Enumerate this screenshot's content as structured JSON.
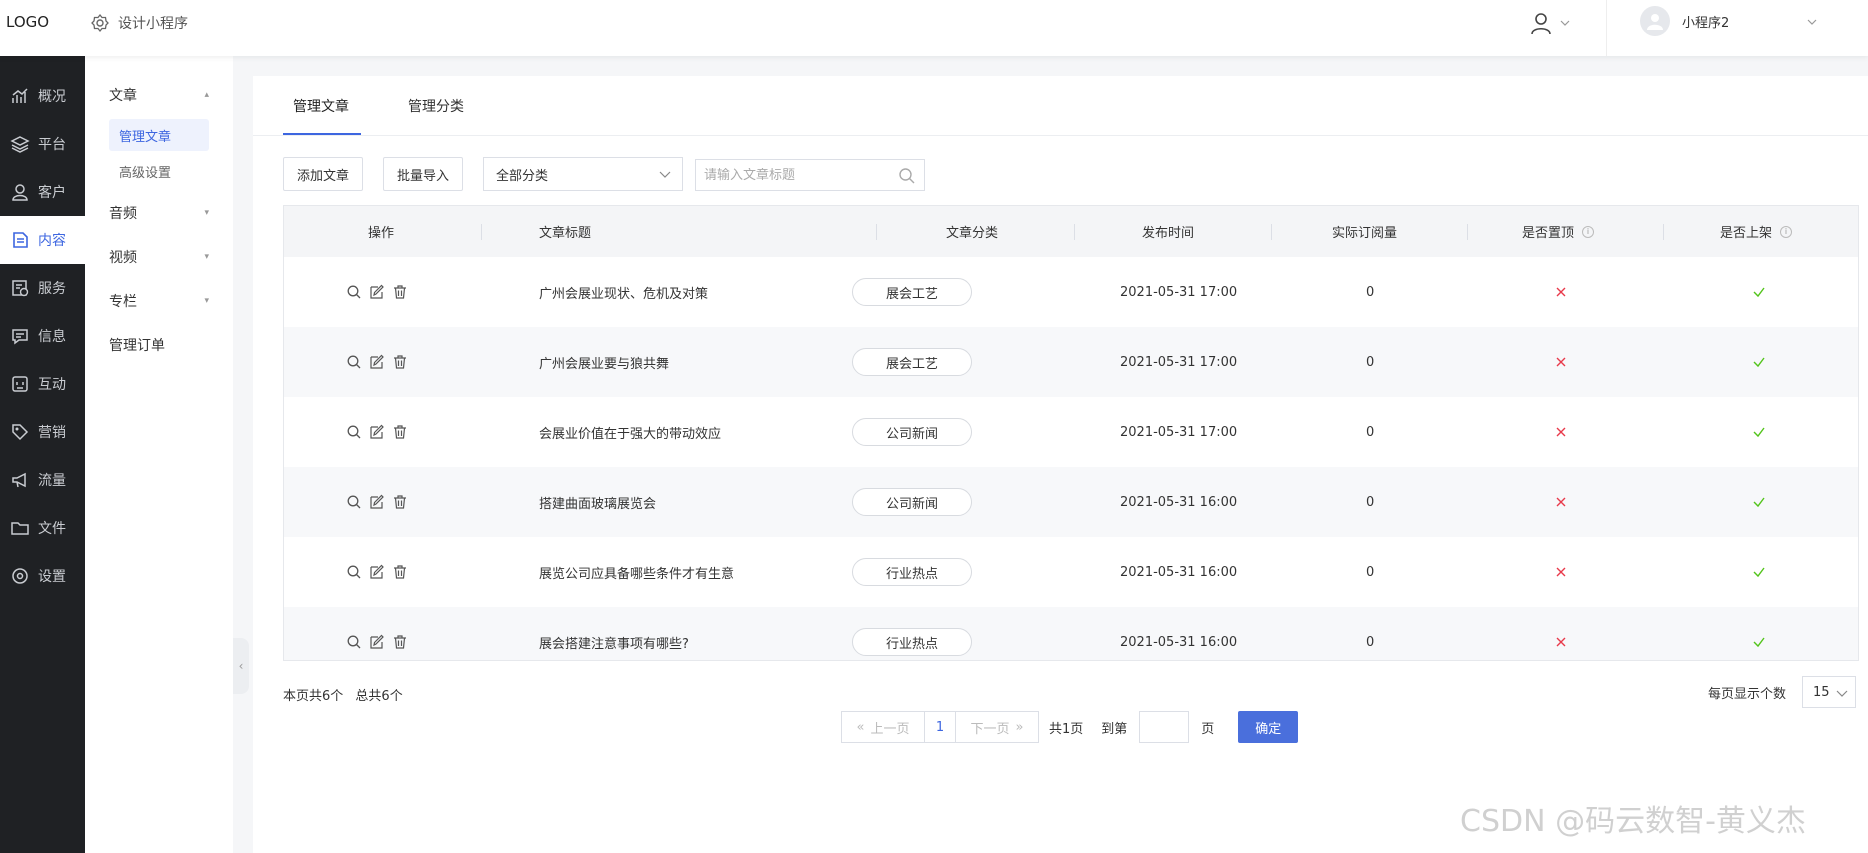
{
  "header": {
    "logo": "LOGO",
    "design_label": "设计小程序",
    "account_name": "小程序2",
    "icons": [
      "user-icon",
      "chevron-down-icon",
      "settings-icon"
    ]
  },
  "leftnav": {
    "items": [
      {
        "label": "概况",
        "icon": "chart-icon"
      },
      {
        "label": "平台",
        "icon": "layers-icon"
      },
      {
        "label": "客户",
        "icon": "user-icon"
      },
      {
        "label": "内容",
        "icon": "document-icon",
        "active": true
      },
      {
        "label": "服务",
        "icon": "service-icon"
      },
      {
        "label": "信息",
        "icon": "message-icon"
      },
      {
        "label": "互动",
        "icon": "interact-icon"
      },
      {
        "label": "营销",
        "icon": "tag-icon"
      },
      {
        "label": "流量",
        "icon": "megaphone-icon"
      },
      {
        "label": "文件",
        "icon": "folder-icon"
      },
      {
        "label": "设置",
        "icon": "gear-icon"
      }
    ]
  },
  "subnav": {
    "group_article": "文章",
    "item_manage_article": "管理文章",
    "item_advanced": "高级设置",
    "group_audio": "音频",
    "group_video": "视频",
    "group_column": "专栏",
    "item_orders": "管理订单"
  },
  "tabs": [
    "管理文章",
    "管理分类"
  ],
  "toolbar": {
    "add_label": "添加文章",
    "import_label": "批量导入",
    "category_selected": "全部分类",
    "search_placeholder": "请输入文章标题"
  },
  "table": {
    "columns": [
      "操作",
      "文章标题",
      "文章分类",
      "发布时间",
      "实际订阅量",
      "是否置顶",
      "是否上架"
    ],
    "rows": [
      {
        "title": "广州会展业现状、危机及对策",
        "category": "展会工艺",
        "time": "2021-05-31 17:00",
        "subs": "0",
        "top": false,
        "listed": true
      },
      {
        "title": "广州会展业要与狼共舞",
        "category": "展会工艺",
        "time": "2021-05-31 17:00",
        "subs": "0",
        "top": false,
        "listed": true
      },
      {
        "title": "会展业价值在于强大的带动效应",
        "category": "公司新闻",
        "time": "2021-05-31 17:00",
        "subs": "0",
        "top": false,
        "listed": true
      },
      {
        "title": "搭建曲面玻璃展览会",
        "category": "公司新闻",
        "time": "2021-05-31 16:00",
        "subs": "0",
        "top": false,
        "listed": true
      },
      {
        "title": "展览公司应具备哪些条件才有生意",
        "category": "行业热点",
        "time": "2021-05-31 16:00",
        "subs": "0",
        "top": false,
        "listed": true
      },
      {
        "title": "展会搭建注意事项有哪些?",
        "category": "行业热点",
        "time": "2021-05-31 16:00",
        "subs": "0",
        "top": false,
        "listed": true
      }
    ]
  },
  "footer": {
    "page_count": "本页共6个",
    "total_count": "总共6个",
    "per_page_label": "每页显示个数",
    "per_page_value": "15",
    "prev": "上一页",
    "current_page": "1",
    "next": "下一页",
    "total_pages": "共1页",
    "goto_label": "到第",
    "page_suffix": "页",
    "confirm": "确定"
  },
  "watermark": "CSDN @码云数智-黄义杰",
  "colors": {
    "accent": "#3d66e0",
    "cross": "#e8394a",
    "check": "#52c41a",
    "nav_bg": "#1f2124"
  }
}
